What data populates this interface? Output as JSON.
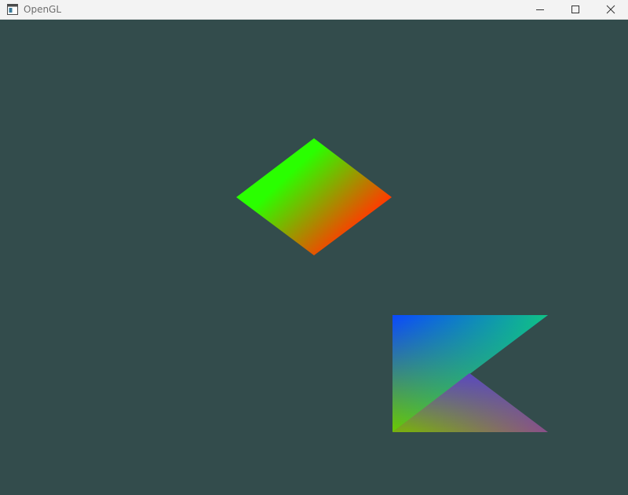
{
  "window": {
    "title": "OpenGL",
    "controls": {
      "minimize_icon": "minimize-icon",
      "maximize_icon": "maximize-icon",
      "close_icon": "close-icon"
    }
  },
  "scene": {
    "clear_color": "#334c4c",
    "shapes": [
      {
        "name": "diamond",
        "colors": [
          "#2aff00",
          "#ff3c00"
        ]
      },
      {
        "name": "upper-triangle",
        "colors": [
          "#0a48ff",
          "#10c384",
          "#6cc800"
        ]
      },
      {
        "name": "lower-triangle",
        "colors": [
          "#5a48bf",
          "#7aae10",
          "#8a4f8a"
        ]
      }
    ]
  }
}
